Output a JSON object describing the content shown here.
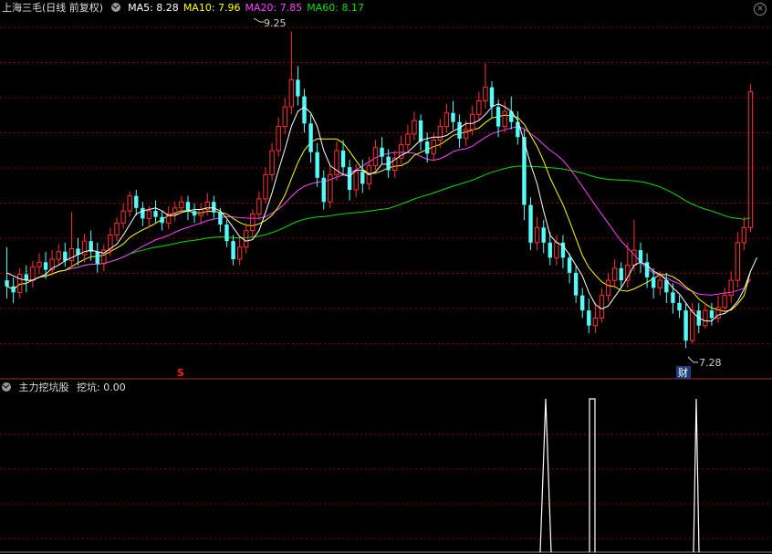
{
  "title": "上海三毛(日线 前复权)",
  "ma_labels": [
    {
      "text": "MA5: 8.28",
      "color": "#ffffff"
    },
    {
      "text": "MA10: 7.96",
      "color": "#ffff00"
    },
    {
      "text": "MA20: 7.85",
      "color": "#ff40ff"
    },
    {
      "text": "MA60: 8.17",
      "color": "#00e000"
    }
  ],
  "close_icon": "close-icon",
  "indicator_title": "主力挖坑股",
  "indicator_value": "挖坑: 0.00",
  "annotations": {
    "high": "9.25",
    "low": "7.28",
    "signal_s": "S",
    "signal_cai": "财"
  },
  "colors": {
    "up": "#ff3232",
    "down": "#54fcfc",
    "grid": "#8b0000",
    "ma5": "#ffffff",
    "ma10": "#ffff00",
    "ma20": "#ff40ff",
    "ma60": "#00e000"
  },
  "chart_data": {
    "type": "candlestick",
    "price_range": [
      7.05,
      9.35
    ],
    "candles": [
      [
        7.6,
        7.56,
        7.82,
        7.48
      ],
      [
        7.56,
        7.52,
        7.62,
        7.45
      ],
      [
        7.52,
        7.64,
        7.68,
        7.48
      ],
      [
        7.64,
        7.6,
        7.7,
        7.52
      ],
      [
        7.6,
        7.69,
        7.73,
        7.55
      ],
      [
        7.69,
        7.72,
        7.78,
        7.64
      ],
      [
        7.72,
        7.67,
        7.79,
        7.61
      ],
      [
        7.67,
        7.74,
        7.8,
        7.63
      ],
      [
        7.74,
        7.79,
        7.84,
        7.7
      ],
      [
        7.79,
        7.73,
        7.85,
        7.69
      ],
      [
        7.73,
        7.81,
        8.05,
        7.69
      ],
      [
        7.81,
        7.77,
        7.88,
        7.7
      ],
      [
        7.77,
        7.86,
        7.91,
        7.72
      ],
      [
        7.86,
        7.79,
        7.93,
        7.73
      ],
      [
        7.79,
        7.71,
        7.85,
        7.65
      ],
      [
        7.71,
        7.8,
        7.84,
        7.66
      ],
      [
        7.8,
        7.9,
        7.95,
        7.76
      ],
      [
        7.9,
        7.98,
        8.02,
        7.86
      ],
      [
        7.98,
        8.06,
        8.11,
        7.94
      ],
      [
        8.06,
        8.16,
        8.19,
        8.02
      ],
      [
        8.16,
        8.08,
        8.2,
        8.03
      ],
      [
        8.08,
        8.01,
        8.12,
        7.96
      ],
      [
        8.01,
        8.06,
        8.09,
        7.95
      ],
      [
        8.06,
        8.02,
        8.13,
        7.98
      ],
      [
        8.02,
        7.98,
        8.06,
        7.93
      ],
      [
        7.98,
        8.04,
        8.09,
        7.94
      ],
      [
        8.04,
        8.08,
        8.12,
        7.99
      ],
      [
        8.08,
        8.12,
        8.16,
        8.05
      ],
      [
        8.12,
        8.06,
        8.16,
        8.0
      ],
      [
        8.06,
        8.03,
        8.11,
        7.98
      ],
      [
        8.03,
        8.07,
        8.11,
        7.97
      ],
      [
        8.07,
        8.12,
        8.18,
        8.03
      ],
      [
        8.12,
        8.05,
        8.16,
        8.01
      ],
      [
        8.05,
        7.97,
        8.08,
        7.92
      ],
      [
        7.97,
        7.86,
        8.0,
        7.82
      ],
      [
        7.86,
        7.74,
        7.9,
        7.7
      ],
      [
        7.74,
        7.82,
        7.88,
        7.7
      ],
      [
        7.82,
        7.93,
        7.98,
        7.78
      ],
      [
        7.93,
        8.04,
        8.07,
        7.89
      ],
      [
        8.04,
        8.14,
        8.19,
        8.0
      ],
      [
        8.14,
        8.3,
        8.35,
        8.11
      ],
      [
        8.3,
        8.46,
        8.51,
        8.26
      ],
      [
        8.46,
        8.62,
        8.68,
        8.42
      ],
      [
        8.62,
        8.75,
        8.81,
        8.57
      ],
      [
        8.75,
        8.93,
        9.25,
        8.7
      ],
      [
        8.93,
        8.82,
        9.02,
        8.76
      ],
      [
        8.82,
        8.64,
        8.87,
        8.58
      ],
      [
        8.64,
        8.45,
        8.7,
        8.38
      ],
      [
        8.45,
        8.28,
        8.51,
        8.22
      ],
      [
        8.28,
        8.12,
        8.33,
        8.07
      ],
      [
        8.12,
        8.3,
        8.36,
        8.08
      ],
      [
        8.3,
        8.46,
        8.52,
        8.26
      ],
      [
        8.46,
        8.35,
        8.53,
        8.3
      ],
      [
        8.35,
        8.2,
        8.4,
        8.13
      ],
      [
        8.2,
        8.32,
        8.37,
        8.15
      ],
      [
        8.32,
        8.24,
        8.4,
        8.18
      ],
      [
        8.24,
        8.36,
        8.42,
        8.2
      ],
      [
        8.36,
        8.48,
        8.53,
        8.33
      ],
      [
        8.48,
        8.42,
        8.55,
        8.37
      ],
      [
        8.42,
        8.33,
        8.47,
        8.28
      ],
      [
        8.33,
        8.41,
        8.46,
        8.28
      ],
      [
        8.41,
        8.5,
        8.56,
        8.37
      ],
      [
        8.5,
        8.57,
        8.63,
        8.46
      ],
      [
        8.57,
        8.66,
        8.72,
        8.53
      ],
      [
        8.66,
        8.52,
        8.7,
        8.46
      ],
      [
        8.52,
        8.44,
        8.58,
        8.38
      ],
      [
        8.44,
        8.53,
        8.58,
        8.39
      ],
      [
        8.53,
        8.62,
        8.67,
        8.48
      ],
      [
        8.62,
        8.71,
        8.77,
        8.58
      ],
      [
        8.71,
        8.65,
        8.79,
        8.6
      ],
      [
        8.65,
        8.54,
        8.7,
        8.48
      ],
      [
        8.54,
        8.6,
        8.66,
        8.49
      ],
      [
        8.6,
        8.7,
        8.76,
        8.56
      ],
      [
        8.7,
        8.79,
        8.85,
        8.66
      ],
      [
        8.79,
        8.88,
        9.04,
        8.74
      ],
      [
        8.88,
        8.75,
        8.92,
        8.68
      ],
      [
        8.75,
        8.62,
        8.8,
        8.55
      ],
      [
        8.62,
        8.72,
        8.79,
        8.58
      ],
      [
        8.72,
        8.65,
        8.82,
        8.6
      ],
      [
        8.65,
        8.55,
        8.72,
        8.5
      ],
      [
        8.55,
        8.1,
        8.6,
        8.0
      ],
      [
        8.1,
        7.85,
        8.15,
        7.8
      ],
      [
        7.85,
        7.95,
        8.02,
        7.8
      ],
      [
        7.95,
        7.85,
        8.0,
        7.78
      ],
      [
        7.85,
        7.75,
        7.92,
        7.7
      ],
      [
        7.75,
        7.85,
        7.9,
        7.7
      ],
      [
        7.85,
        7.75,
        7.9,
        7.68
      ],
      [
        7.75,
        7.65,
        7.78,
        7.58
      ],
      [
        7.65,
        7.5,
        7.7,
        7.45
      ],
      [
        7.5,
        7.4,
        7.55,
        7.35
      ],
      [
        7.4,
        7.3,
        7.48,
        7.25
      ],
      [
        7.3,
        7.35,
        7.45,
        7.25
      ],
      [
        7.35,
        7.5,
        7.55,
        7.32
      ],
      [
        7.5,
        7.6,
        7.65,
        7.46
      ],
      [
        7.6,
        7.68,
        7.74,
        7.55
      ],
      [
        7.68,
        7.6,
        7.72,
        7.55
      ],
      [
        7.6,
        7.7,
        7.85,
        7.55
      ],
      [
        7.7,
        7.8,
        8.0,
        7.66
      ],
      [
        7.8,
        7.72,
        7.85,
        7.65
      ],
      [
        7.72,
        7.62,
        7.78,
        7.55
      ],
      [
        7.62,
        7.55,
        7.68,
        7.48
      ],
      [
        7.55,
        7.6,
        7.66,
        7.5
      ],
      [
        7.6,
        7.52,
        7.65,
        7.45
      ],
      [
        7.52,
        7.45,
        7.58,
        7.38
      ],
      [
        7.45,
        7.4,
        7.5,
        7.35
      ],
      [
        7.4,
        7.2,
        7.45,
        7.15
      ],
      [
        7.2,
        7.4,
        7.45,
        7.18
      ],
      [
        7.4,
        7.3,
        7.45,
        7.25
      ],
      [
        7.3,
        7.4,
        7.45,
        7.28
      ],
      [
        7.4,
        7.35,
        7.45,
        7.3
      ],
      [
        7.35,
        7.42,
        7.5,
        7.32
      ],
      [
        7.42,
        7.5,
        7.55,
        7.4
      ],
      [
        7.5,
        7.6,
        7.66,
        7.45
      ],
      [
        7.6,
        7.85,
        7.92,
        7.55
      ],
      [
        7.85,
        7.95,
        8.02,
        7.8
      ],
      [
        7.95,
        8.85,
        8.9,
        7.92
      ]
    ],
    "ma": {
      "MA5": [
        7.65,
        7.63,
        7.61,
        7.6,
        7.6,
        7.62,
        7.64,
        7.68,
        7.7,
        7.73,
        7.75,
        7.77,
        7.79,
        7.8,
        7.79,
        7.78,
        7.81,
        7.84,
        7.9,
        7.97,
        8.04,
        8.06,
        8.07,
        8.08,
        8.06,
        8.03,
        8.03,
        8.05,
        8.06,
        8.07,
        8.07,
        8.08,
        8.08,
        8.06,
        8.01,
        7.95,
        7.89,
        7.86,
        7.87,
        7.93,
        8.05,
        8.18,
        8.33,
        8.47,
        8.62,
        8.72,
        8.75,
        8.71,
        8.62,
        8.46,
        8.36,
        8.33,
        8.3,
        8.29,
        8.33,
        8.33,
        8.3,
        8.32,
        8.37,
        8.37,
        8.4,
        8.43,
        8.45,
        8.49,
        8.53,
        8.54,
        8.55,
        8.55,
        8.56,
        8.59,
        8.61,
        8.64,
        8.64,
        8.66,
        8.7,
        8.75,
        8.77,
        8.75,
        8.72,
        8.66,
        8.52,
        8.37,
        8.24,
        8.06,
        7.9,
        7.85,
        7.83,
        7.77,
        7.7,
        7.63,
        7.52,
        7.44,
        7.41,
        7.43,
        7.49,
        7.55,
        7.62,
        7.7,
        7.72,
        7.7,
        7.66,
        7.64,
        7.6,
        7.55,
        7.51,
        7.45,
        7.39,
        7.35,
        7.33,
        7.33,
        7.37,
        7.38,
        7.41,
        7.46,
        7.54,
        7.66,
        7.75
      ]
    }
  }
}
